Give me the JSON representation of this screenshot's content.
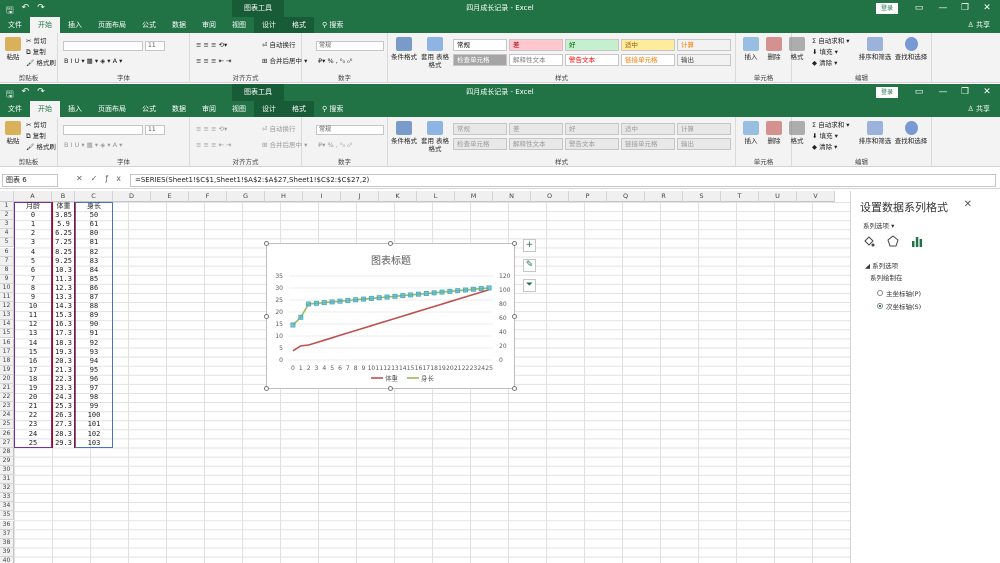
{
  "app": {
    "window_title": "四月成长记录  -  Excel",
    "chart_tools": "图表工具",
    "login": "登录",
    "share": "共享",
    "tabs": [
      "文件",
      "开始",
      "插入",
      "页面布局",
      "公式",
      "数据",
      "审阅",
      "视图",
      "设计",
      "格式"
    ],
    "tell_me": "搜索"
  },
  "ribbon": {
    "clipboard": {
      "paste": "粘贴",
      "cut": "剪切",
      "copy": "复制",
      "format_painter": "格式刷",
      "label": "剪贴板"
    },
    "font": {
      "size": "11",
      "label": "字体"
    },
    "alignment": {
      "wrap": "自动换行",
      "merge": "合并后居中",
      "label": "对齐方式"
    },
    "number": {
      "format": "常规",
      "label": "数字"
    },
    "styles": {
      "cond": "条件格式",
      "table": "套用\n表格格式",
      "label": "样式",
      "items": [
        {
          "text": "常规",
          "bg": "#ffffff",
          "fg": "#000000"
        },
        {
          "text": "差",
          "bg": "#ffc7ce",
          "fg": "#9c0006"
        },
        {
          "text": "好",
          "bg": "#c6efce",
          "fg": "#006100"
        },
        {
          "text": "适中",
          "bg": "#ffeb9c",
          "fg": "#9c5700"
        },
        {
          "text": "计算",
          "bg": "#f2f2f2",
          "fg": "#fa7d00"
        },
        {
          "text": "检查单元格",
          "bg": "#a5a5a5",
          "fg": "#ffffff"
        },
        {
          "text": "解释性文本",
          "bg": "#ffffff",
          "fg": "#7f7f7f"
        },
        {
          "text": "警告文本",
          "bg": "#ffffff",
          "fg": "#ff0000"
        },
        {
          "text": "链接单元格",
          "bg": "#ffffff",
          "fg": "#fa7d00"
        },
        {
          "text": "输出",
          "bg": "#f2f2f2",
          "fg": "#3f3f3f"
        }
      ]
    },
    "cells": {
      "insert": "插入",
      "delete": "删除",
      "format": "格式",
      "label": "单元格"
    },
    "editing": {
      "autosum": "自动求和",
      "fill": "填充",
      "clear": "清除",
      "sort": "排序和筛选",
      "find": "查找和选择",
      "label": "编辑"
    }
  },
  "formula_bar": {
    "name_box": "图表 6",
    "formula": "=SERIES(Sheet1!$C$1,Sheet1!$A$2:$A$27,Sheet1!$C$2:$C$27,2)"
  },
  "sheet": {
    "columns": [
      "A",
      "B",
      "C",
      "D",
      "E",
      "F",
      "G",
      "H",
      "I",
      "J",
      "K",
      "L",
      "M",
      "N",
      "O",
      "P",
      "Q",
      "R",
      "S",
      "T",
      "U",
      "V"
    ],
    "rows": 40,
    "headers": [
      "月龄",
      "体重",
      "身长"
    ],
    "months": [
      "0",
      "1",
      "2",
      "3",
      "4",
      "5",
      "6",
      "7",
      "8",
      "9",
      "10",
      "11",
      "12",
      "13",
      "14",
      "15",
      "16",
      "17",
      "18",
      "19",
      "20",
      "21",
      "22",
      "23",
      "24",
      "25"
    ],
    "weights": [
      "3.85",
      "5.9",
      "6.25",
      "7.25",
      "8.25",
      "9.25",
      "10.3",
      "11.3",
      "12.3",
      "13.3",
      "14.3",
      "15.3",
      "16.3",
      "17.3",
      "18.3",
      "19.3",
      "20.3",
      "21.3",
      "22.3",
      "23.3",
      "24.3",
      "25.3",
      "26.3",
      "27.3",
      "28.3",
      "29.3"
    ],
    "lengths": [
      "50",
      "61",
      "80",
      "81",
      "82",
      "83",
      "84",
      "85",
      "86",
      "87",
      "88",
      "89",
      "90",
      "91",
      "92",
      "93",
      "94",
      "95",
      "96",
      "97",
      "98",
      "99",
      "100",
      "101",
      "102",
      "103"
    ]
  },
  "chart_data": {
    "type": "line",
    "title": "图表标题",
    "categories": [
      "0",
      "1",
      "2",
      "3",
      "4",
      "5",
      "6",
      "7",
      "8",
      "9",
      "10",
      "11",
      "12",
      "13",
      "14",
      "15",
      "16",
      "17",
      "18",
      "19",
      "20",
      "21",
      "22",
      "23",
      "24",
      "25"
    ],
    "series": [
      {
        "name": "体重",
        "axis": "primary",
        "color": "#c0504d",
        "values": [
          3.85,
          5.9,
          6.25,
          7.25,
          8.25,
          9.25,
          10.3,
          11.3,
          12.3,
          13.3,
          14.3,
          15.3,
          16.3,
          17.3,
          18.3,
          19.3,
          20.3,
          21.3,
          22.3,
          23.3,
          24.3,
          25.3,
          26.3,
          27.3,
          28.3,
          29.3
        ]
      },
      {
        "name": "身长",
        "axis": "secondary",
        "color": "#9bbb59",
        "values": [
          50,
          61,
          80,
          81,
          82,
          83,
          84,
          85,
          86,
          87,
          88,
          89,
          90,
          91,
          92,
          93,
          94,
          95,
          96,
          97,
          98,
          99,
          100,
          101,
          102,
          103
        ]
      }
    ],
    "primary_axis": {
      "min": 0,
      "max": 35,
      "step": 5,
      "ticks": [
        "0",
        "5",
        "10",
        "15",
        "20",
        "25",
        "30",
        "35"
      ]
    },
    "secondary_axis": {
      "min": 0,
      "max": 120,
      "step": 20,
      "ticks": [
        "0",
        "20",
        "40",
        "60",
        "80",
        "100",
        "120"
      ]
    },
    "legend": "bottom",
    "grid": true
  },
  "format_pane": {
    "title": "设置数据系列格式",
    "options_label": "系列选项",
    "section": "系列选项",
    "plot_on": "系列绘制在",
    "primary": "主坐标轴(P)",
    "secondary": "次坐标轴(S)",
    "selected": "secondary"
  }
}
